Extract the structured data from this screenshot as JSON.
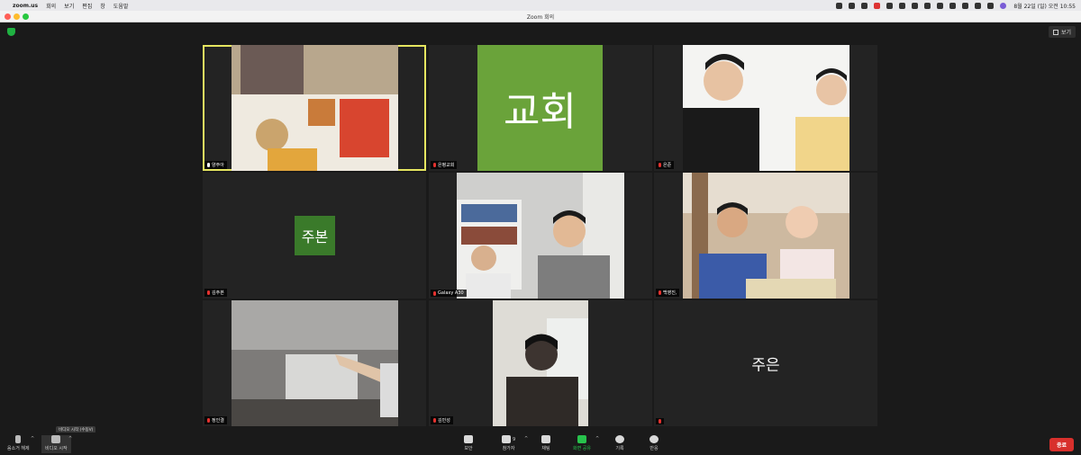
{
  "menubar": {
    "app_name": "zoom.us",
    "menus": [
      "회의",
      "보기",
      "편집",
      "창",
      "도움말"
    ],
    "clock": "8월 22일 (일) 오전 10:55"
  },
  "window": {
    "title": "Zoom 회의"
  },
  "view_button": {
    "label": "보기"
  },
  "participants": [
    {
      "name": "양주아",
      "type": "video",
      "muted": false,
      "active": true
    },
    {
      "name": "은평교회",
      "type": "text",
      "display": "교회",
      "muted": true
    },
    {
      "name": "은준",
      "type": "video",
      "muted": true
    },
    {
      "name": "김주본",
      "type": "text",
      "display": "주본",
      "muted": true
    },
    {
      "name": "Galaxy A30",
      "type": "video",
      "muted": true
    },
    {
      "name": "백영진,",
      "type": "video",
      "muted": true
    },
    {
      "name": "정인결",
      "type": "video",
      "muted": true
    },
    {
      "name": "김민성",
      "type": "video",
      "muted": true
    },
    {
      "name": "",
      "type": "text",
      "display": "주은",
      "muted": true
    }
  ],
  "toolbar": {
    "mute_label": "음소거 해제",
    "video_label": "비디오 시작",
    "video_tooltip": "비디오 시작 (수동V)",
    "security_label": "보안",
    "participants_label": "참가자",
    "participants_count": "9",
    "chat_label": "채팅",
    "share_label": "화면 공유",
    "record_label": "기록",
    "reactions_label": "반응",
    "end_label": "종료"
  },
  "colors": {
    "active_speaker": "#e6e660",
    "church_tile_green": "#6aa33a",
    "jubon_tile_green": "#3a7a2a",
    "end_button": "#d8302c"
  }
}
